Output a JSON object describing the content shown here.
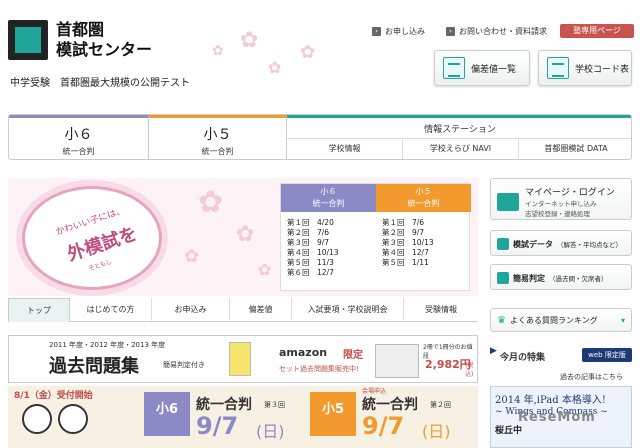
{
  "logo": {
    "line1": "首都圏",
    "line2": "模試センター"
  },
  "tagline": "中学受験　首都圏最大規模の公開テスト",
  "top_links": {
    "apply": "お申し込み",
    "contact": "お問い合わせ・資料請求",
    "exclusive": "塾専用ページ"
  },
  "quick": {
    "hensachi": "偏差値一覧",
    "school_code": "学校コード表"
  },
  "nav": {
    "sho6": {
      "title": "小６",
      "sub": "統一合判"
    },
    "sho5": {
      "title": "小５",
      "sub": "統一合判"
    },
    "station": {
      "title": "情報ステーション",
      "items": [
        "学校情報",
        "学校えらび NAVI",
        "首都圏模試 DATA"
      ]
    }
  },
  "hero": {
    "line1": "かわいい子には、",
    "line2": "外模試を",
    "line3": "そともし"
  },
  "schedule": {
    "sho6": {
      "title": "小６",
      "sub": "統一合判",
      "rows": [
        "第１回　4/20",
        "第２回　7/6",
        "第３回　9/7",
        "第４回　10/13",
        "第５回　11/3",
        "第６回　12/7"
      ]
    },
    "sho5": {
      "title": "小５",
      "sub": "統一合判",
      "rows": [
        "第１回　7/6",
        "第２回　9/7",
        "第３回　10/13",
        "第４回　12/7",
        "第５回　1/11"
      ]
    }
  },
  "subtabs": [
    "トップ",
    "はじめての方",
    "お申込み",
    "偏差値",
    "入試要項・学校説明会",
    "受験情報"
  ],
  "side": {
    "mypage": "マイページ・ログイン",
    "mypage_sub1": "インターネット申し込み",
    "mypage_sub2": "志望校登録・連絡処理",
    "data": "模試データ",
    "data_sub": "（解答・平均点など）",
    "judge": "簡易判定",
    "judge_sub": "（過去問・欠席者）",
    "faq": "よくある質問ランキング"
  },
  "banner_kako": {
    "years": "2011 年度・2012 年度・2013 年度",
    "title": "過去問題集",
    "note": "簡易判定付き",
    "amazon": "amazon",
    "limited": "限定",
    "amazon_sub": "セット過去問題集販売中!",
    "price_note": "2冊で1冊分のお値段",
    "price": "2,982円",
    "price_tax": "(税込)"
  },
  "tokushu": {
    "title": "今月の特集",
    "badge": "web 限定版",
    "past": "過去の記事はこちら"
  },
  "ipad": {
    "line1": "2014 年,iPad 本格導入!",
    "line2": "~ Wings and Compass ~",
    "line3": "桜丘中"
  },
  "banner_exam": {
    "open": "8/1（金）受付開始",
    "sho6": "小6",
    "sho6_title": "統一合判",
    "sho6_round": "第３回",
    "sho6_date": "9/7",
    "sho6_day": "(日)",
    "sho5": "小5",
    "sho5_note": "会場申込",
    "sho5_title": "統一合判",
    "sho5_round": "第２回",
    "sho5_date": "9/7",
    "sho5_day": "(日)"
  },
  "watermark": "ReseMom",
  "colors": {
    "teal": "#1fa59a",
    "sho6": "#8b8ac6",
    "sho5": "#f29a2e",
    "pink": "#c04c7e"
  }
}
